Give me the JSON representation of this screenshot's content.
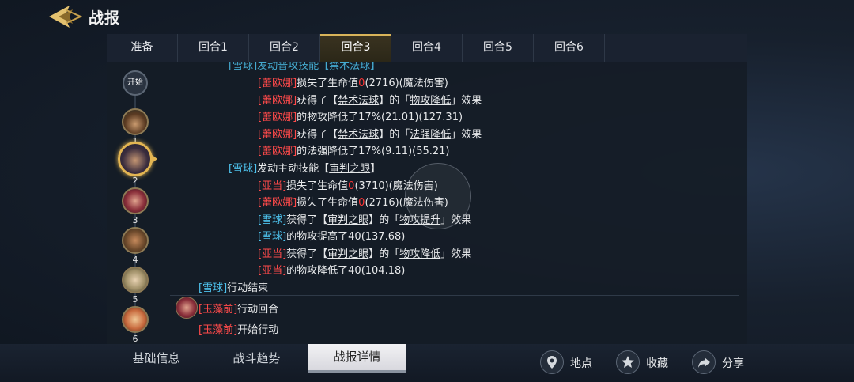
{
  "header": {
    "title": "战报"
  },
  "tabs": [
    {
      "label": "准备"
    },
    {
      "label": "回合1"
    },
    {
      "label": "回合2"
    },
    {
      "label": "回合3"
    },
    {
      "label": "回合4"
    },
    {
      "label": "回合5"
    },
    {
      "label": "回合6"
    }
  ],
  "active_tab": "回合3",
  "timeline": {
    "start_label": "开始",
    "nodes": [
      {
        "num": "1"
      },
      {
        "num": "2"
      },
      {
        "num": "3"
      },
      {
        "num": "4"
      },
      {
        "num": "5"
      },
      {
        "num": "6"
      }
    ],
    "selected": "2"
  },
  "log": {
    "partial_top": "[雪球]发动普攻技能【禁术法球】",
    "l1": {
      "name": "[蕾欧娜]",
      "a": "损失了生命值",
      "zero": "0",
      "b": "(2716)(魔法伤害)"
    },
    "l2": {
      "name": "[蕾欧娜]",
      "a": "获得了【",
      "skill": "禁术法球",
      "b": "】的「",
      "effect": "物攻降低",
      "c": "」效果"
    },
    "l3": {
      "name": "[蕾欧娜]",
      "a": "的物攻降低了17%(21.01)(127.31)"
    },
    "l4": {
      "name": "[蕾欧娜]",
      "a": "获得了【",
      "skill": "禁术法球",
      "b": "】的「",
      "effect": "法强降低",
      "c": "」效果"
    },
    "l5": {
      "name": "[蕾欧娜]",
      "a": "的法强降低了17%(9.11)(55.21)"
    },
    "l6": {
      "name": "[雪球]",
      "a": "发动主动技能【",
      "skill": "审判之眼",
      "b": "】"
    },
    "l7": {
      "name": "[亚当]",
      "a": "损失了生命值",
      "zero": "0",
      "b": "(3710)(魔法伤害)"
    },
    "l8": {
      "name": "[蕾欧娜]",
      "a": "损失了生命值",
      "zero": "0",
      "b": "(2716)(魔法伤害)"
    },
    "l9": {
      "name": "[雪球]",
      "a": "获得了【",
      "skill": "审判之眼",
      "b": "】的「",
      "effect": "物攻提升",
      "c": "」效果"
    },
    "l10": {
      "name": "[雪球]",
      "a": "的物攻提高了40(137.68)"
    },
    "l11": {
      "name": "[亚当]",
      "a": "获得了【",
      "skill": "审判之眼",
      "b": "】的「",
      "effect": "物攻降低",
      "c": "」效果"
    },
    "l12": {
      "name": "[亚当]",
      "a": "的物攻降低了40(104.18)"
    },
    "l13": {
      "name": "[雪球]",
      "a": "行动结束"
    },
    "l14": {
      "name": "[玉藻前]",
      "a": "行动回合"
    },
    "l15": {
      "name": "[玉藻前]",
      "a": "开始行动"
    }
  },
  "bottom_tabs": [
    {
      "label": "基础信息"
    },
    {
      "label": "战斗趋势"
    },
    {
      "label": "战报详情"
    }
  ],
  "active_bottom_tab": "战报详情",
  "actions": [
    {
      "label": "地点",
      "icon": "location-pin-icon"
    },
    {
      "label": "收藏",
      "icon": "star-icon"
    },
    {
      "label": "分享",
      "icon": "share-arrow-icon"
    }
  ],
  "colors": {
    "enemy": "#ff4a4a",
    "ally": "#4ec3ee",
    "accent": "#e3b552"
  }
}
